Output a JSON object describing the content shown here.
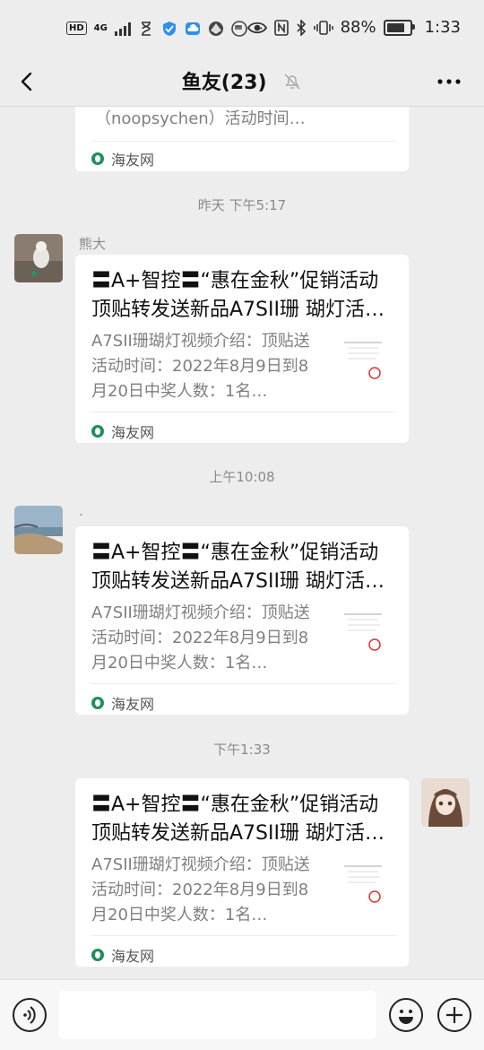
{
  "status_bar": {
    "hd": "HD",
    "network": "4G",
    "battery_text": "88%",
    "battery_level": 0.88,
    "time": "1:33"
  },
  "nav": {
    "title": "鱼友(23)"
  },
  "messages": [
    {
      "desc_tail": "（noopsychen）活动时间…",
      "source": "海友网"
    },
    {
      "time": "昨天 下午5:17",
      "sender": "熊大",
      "title": "〓A+智控〓“惠在金秋”促销活动顶贴转发送新品A7SII珊 瑚灯活…",
      "desc": "A7SII珊瑚灯视频介绍：顶贴送活动时间：2022年8月9日到8月20日中奖人数：1名…",
      "source": "海友网"
    },
    {
      "time": "上午10:08",
      "sender": ".",
      "title": "〓A+智控〓“惠在金秋”促销活动顶贴转发送新品A7SII珊 瑚灯活…",
      "desc": "A7SII珊瑚灯视频介绍：顶贴送活动时间：2022年8月9日到8月20日中奖人数：1名…",
      "source": "海友网"
    },
    {
      "time": "下午1:33",
      "title": "〓A+智控〓“惠在金秋”促销活动顶贴转发送新品A7SII珊 瑚灯活…",
      "desc": "A7SII珊瑚灯视频介绍：顶贴送活动时间：2022年8月9日到8月20日中奖人数：1名…",
      "source": "海友网"
    }
  ],
  "icons": {
    "back": "back-arrow-icon",
    "mute": "bell-muted-icon",
    "more": "more-icon",
    "voice": "voice-icon",
    "emoji": "emoji-icon",
    "add": "plus-icon"
  },
  "colors": {
    "background": "#ededed",
    "bubble": "#ffffff",
    "timestamp": "#8a8a8a",
    "link_source": "#1f8f5a"
  }
}
